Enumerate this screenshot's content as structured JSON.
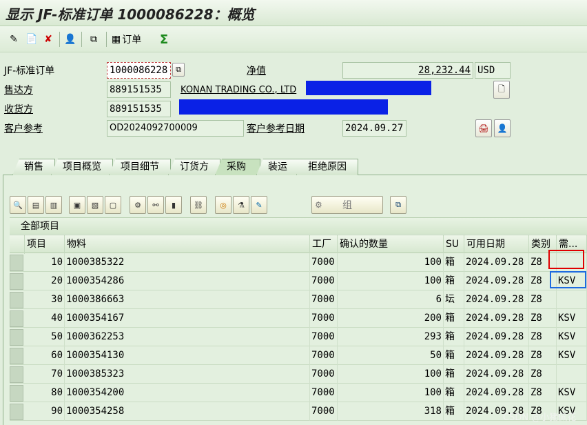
{
  "title": "显示 JF-标准订单 1000086228：概览",
  "toolbar": {
    "order_label": "订单",
    "icons": [
      "display-change-icon",
      "create-document-icon",
      "delete-icon",
      "partner-icon",
      "copy-icon",
      "order-icon",
      "sum-icon"
    ]
  },
  "header": {
    "order_type_label": "JF-标准订单",
    "order_number": "1000086228",
    "net_value_label": "净值",
    "net_value": "28,232.44",
    "currency": "USD",
    "sold_to_label": "售达方",
    "sold_to_number": "889151535",
    "sold_to_name": "KONAN TRADING CO., LTD",
    "ship_to_label": "收货方",
    "ship_to_number": "889151535",
    "customer_ref_label": "客户参考",
    "customer_ref": "OD2024092700009",
    "customer_ref_date_label": "客户参考日期",
    "customer_ref_date": "2024.09.27"
  },
  "tabs": [
    "销售",
    "项目概览",
    "项目细节",
    "订货方",
    "采购",
    "装运",
    "拒绝原因"
  ],
  "active_tab": "采购",
  "items_toolbar": {
    "group_label": "组"
  },
  "grid": {
    "title": "全部项目",
    "columns": [
      "项目",
      "物料",
      "工厂",
      "确认的数量",
      "SU",
      "可用日期",
      "类别",
      "需..."
    ],
    "rows": [
      {
        "item": "10",
        "material": "1000385322",
        "plant": "7000",
        "qty": "100",
        "su": "箱",
        "date": "2024.09.28",
        "cat": "Z8",
        "req": ""
      },
      {
        "item": "20",
        "material": "1000354286",
        "plant": "7000",
        "qty": "100",
        "su": "箱",
        "date": "2024.09.28",
        "cat": "Z8",
        "req": "KSV"
      },
      {
        "item": "30",
        "material": "1000386663",
        "plant": "7000",
        "qty": "6",
        "su": "坛",
        "date": "2024.09.28",
        "cat": "Z8",
        "req": ""
      },
      {
        "item": "40",
        "material": "1000354167",
        "plant": "7000",
        "qty": "200",
        "su": "箱",
        "date": "2024.09.28",
        "cat": "Z8",
        "req": "KSV"
      },
      {
        "item": "50",
        "material": "1000362253",
        "plant": "7000",
        "qty": "293",
        "su": "箱",
        "date": "2024.09.28",
        "cat": "Z8",
        "req": "KSV"
      },
      {
        "item": "60",
        "material": "1000354130",
        "plant": "7000",
        "qty": "50",
        "su": "箱",
        "date": "2024.09.28",
        "cat": "Z8",
        "req": "KSV"
      },
      {
        "item": "70",
        "material": "1000385323",
        "plant": "7000",
        "qty": "100",
        "su": "箱",
        "date": "2024.09.28",
        "cat": "Z8",
        "req": ""
      },
      {
        "item": "80",
        "material": "1000354200",
        "plant": "7000",
        "qty": "100",
        "su": "箱",
        "date": "2024.09.28",
        "cat": "Z8",
        "req": "KSV"
      },
      {
        "item": "90",
        "material": "1000354258",
        "plant": "7000",
        "qty": "318",
        "su": "箱",
        "date": "2024.09.28",
        "cat": "Z8",
        "req": "KSV"
      }
    ]
  },
  "watermark": "CSDN @小猪佩花"
}
